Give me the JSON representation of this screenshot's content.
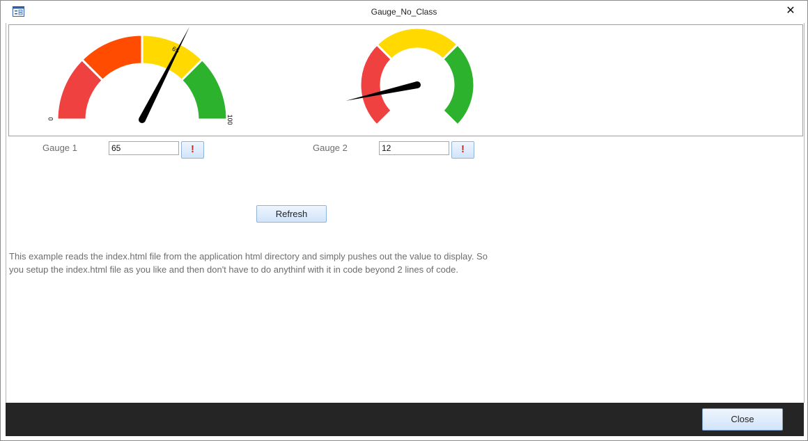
{
  "window": {
    "title": "Gauge_No_Class",
    "icon": "form-icon",
    "close_glyph": "✕"
  },
  "gauges": [
    {
      "name": "Gauge 1",
      "value": 65,
      "min_label": "0",
      "max_label": "100",
      "value_label": "65",
      "colors": [
        "#f04141",
        "#ff4c00",
        "#ffd900",
        "#2db22d"
      ]
    },
    {
      "name": "Gauge 2",
      "value": 12,
      "colors": [
        "#f04141",
        "#ffd900",
        "#2db22d"
      ]
    }
  ],
  "controls": {
    "gauge1_label": "Gauge 1",
    "gauge1_value": "65",
    "gauge2_label": "Gauge 2",
    "gauge2_value": "12",
    "set_button_glyph": "!",
    "refresh_label": "Refresh"
  },
  "description": "This example reads the index.html file from the application html directory and simply pushes out the value to display.  So you setup the index.html file as you like and then don't have to do anythinf with it in code beyond 2 lines of code.",
  "footer": {
    "close_label": "Close"
  }
}
